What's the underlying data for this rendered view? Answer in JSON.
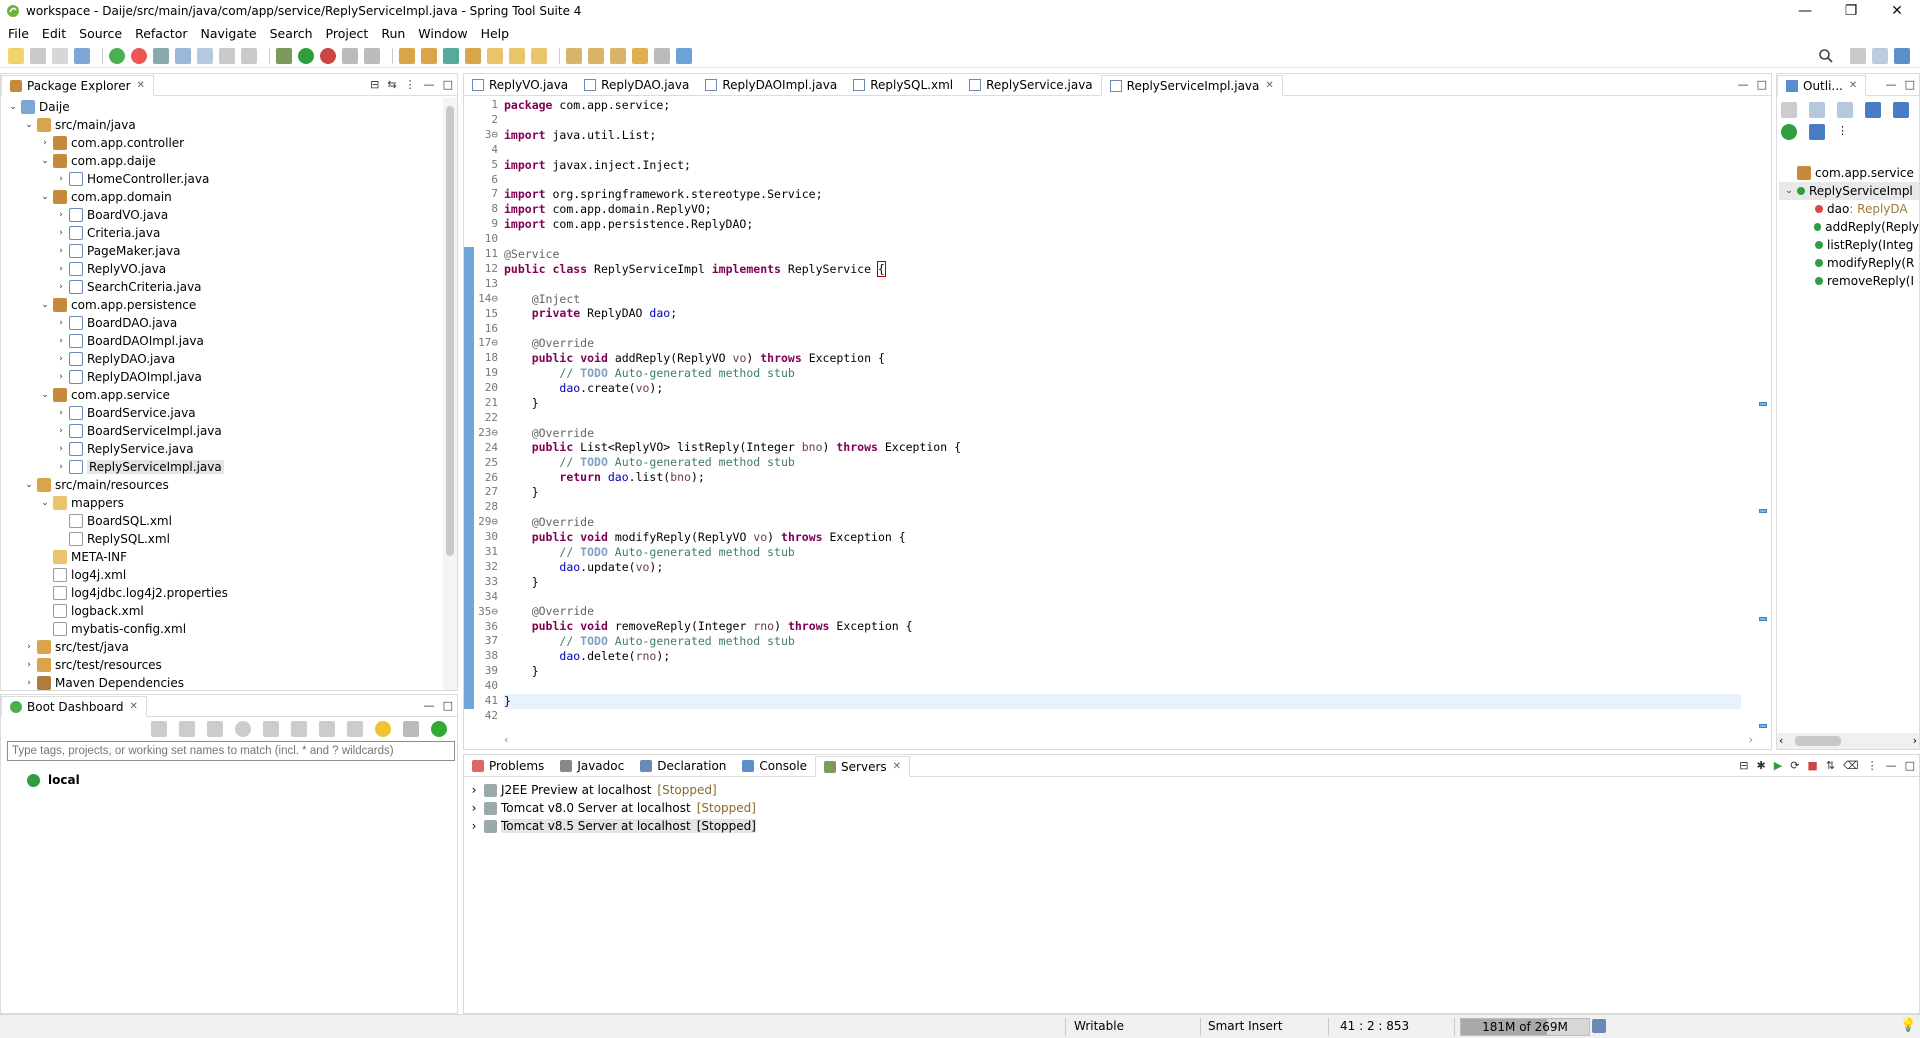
{
  "window": {
    "title": "workspace - Daije/src/main/java/com/app/service/ReplyServiceImpl.java - Spring Tool Suite 4",
    "minimize": "—",
    "restore": "❐",
    "close": "✕"
  },
  "menu": [
    "File",
    "Edit",
    "Source",
    "Refactor",
    "Navigate",
    "Search",
    "Project",
    "Run",
    "Window",
    "Help"
  ],
  "package_explorer": {
    "title": "Package Explorer",
    "tree": [
      {
        "label": "Daije",
        "depth": 0,
        "twisty": "⌄",
        "icon": "proj"
      },
      {
        "label": "src/main/java",
        "depth": 1,
        "twisty": "⌄",
        "icon": "src"
      },
      {
        "label": "com.app.controller",
        "depth": 2,
        "twisty": "›",
        "icon": "pkg"
      },
      {
        "label": "com.app.daije",
        "depth": 2,
        "twisty": "⌄",
        "icon": "pkg"
      },
      {
        "label": "HomeController.java",
        "depth": 3,
        "twisty": "›",
        "icon": "java"
      },
      {
        "label": "com.app.domain",
        "depth": 2,
        "twisty": "⌄",
        "icon": "pkg"
      },
      {
        "label": "BoardVO.java",
        "depth": 3,
        "twisty": "›",
        "icon": "java"
      },
      {
        "label": "Criteria.java",
        "depth": 3,
        "twisty": "›",
        "icon": "java"
      },
      {
        "label": "PageMaker.java",
        "depth": 3,
        "twisty": "›",
        "icon": "java"
      },
      {
        "label": "ReplyVO.java",
        "depth": 3,
        "twisty": "›",
        "icon": "java"
      },
      {
        "label": "SearchCriteria.java",
        "depth": 3,
        "twisty": "›",
        "icon": "java"
      },
      {
        "label": "com.app.persistence",
        "depth": 2,
        "twisty": "⌄",
        "icon": "pkg"
      },
      {
        "label": "BoardDAO.java",
        "depth": 3,
        "twisty": "›",
        "icon": "java"
      },
      {
        "label": "BoardDAOImpl.java",
        "depth": 3,
        "twisty": "›",
        "icon": "java"
      },
      {
        "label": "ReplyDAO.java",
        "depth": 3,
        "twisty": "›",
        "icon": "java"
      },
      {
        "label": "ReplyDAOImpl.java",
        "depth": 3,
        "twisty": "›",
        "icon": "java"
      },
      {
        "label": "com.app.service",
        "depth": 2,
        "twisty": "⌄",
        "icon": "pkg"
      },
      {
        "label": "BoardService.java",
        "depth": 3,
        "twisty": "›",
        "icon": "java"
      },
      {
        "label": "BoardServiceImpl.java",
        "depth": 3,
        "twisty": "›",
        "icon": "java"
      },
      {
        "label": "ReplyService.java",
        "depth": 3,
        "twisty": "›",
        "icon": "java"
      },
      {
        "label": "ReplyServiceImpl.java",
        "depth": 3,
        "twisty": "›",
        "icon": "java",
        "selected": true
      },
      {
        "label": "src/main/resources",
        "depth": 1,
        "twisty": "⌄",
        "icon": "src"
      },
      {
        "label": "mappers",
        "depth": 2,
        "twisty": "⌄",
        "icon": "folder"
      },
      {
        "label": "BoardSQL.xml",
        "depth": 3,
        "twisty": "",
        "icon": "xml"
      },
      {
        "label": "ReplySQL.xml",
        "depth": 3,
        "twisty": "",
        "icon": "xml"
      },
      {
        "label": "META-INF",
        "depth": 2,
        "twisty": "",
        "icon": "folder"
      },
      {
        "label": "log4j.xml",
        "depth": 2,
        "twisty": "",
        "icon": "xml"
      },
      {
        "label": "log4jdbc.log4j2.properties",
        "depth": 2,
        "twisty": "",
        "icon": "xml"
      },
      {
        "label": "logback.xml",
        "depth": 2,
        "twisty": "",
        "icon": "xml"
      },
      {
        "label": "mybatis-config.xml",
        "depth": 2,
        "twisty": "",
        "icon": "xml"
      },
      {
        "label": "src/test/java",
        "depth": 1,
        "twisty": "›",
        "icon": "src"
      },
      {
        "label": "src/test/resources",
        "depth": 1,
        "twisty": "›",
        "icon": "src"
      },
      {
        "label": "Maven Dependencies",
        "depth": 1,
        "twisty": "›",
        "icon": "lib"
      }
    ]
  },
  "boot_dashboard": {
    "title": "Boot Dashboard",
    "filter_placeholder": "Type tags, projects, or working set names to match (incl. * and ? wildcards)",
    "items": [
      "local"
    ]
  },
  "editor": {
    "tabs": [
      "ReplyVO.java",
      "ReplyDAO.java",
      "ReplyDAOImpl.java",
      "ReplySQL.xml",
      "ReplyService.java",
      "ReplyServiceImpl.java"
    ],
    "active_tab": 5,
    "current_line": 41,
    "lines": [
      {
        "n": 1,
        "h": "<span class=\"kw\">package</span> com.app.service;"
      },
      {
        "n": 2,
        "h": ""
      },
      {
        "n": 3,
        "h": "<span class=\"kw\">import</span> java.util.List;",
        "fold": true
      },
      {
        "n": 4,
        "h": ""
      },
      {
        "n": 5,
        "h": "<span class=\"kw\">import</span> javax.inject.Inject;"
      },
      {
        "n": 6,
        "h": ""
      },
      {
        "n": 7,
        "h": "<span class=\"kw\">import</span> org.springframework.stereotype.Service;"
      },
      {
        "n": 8,
        "h": "<span class=\"kw\">import</span> com.app.domain.ReplyVO;"
      },
      {
        "n": 9,
        "h": "<span class=\"kw\">import</span> com.app.persistence.ReplyDAO;"
      },
      {
        "n": 10,
        "h": ""
      },
      {
        "n": 11,
        "h": "<span class=\"ann\">@Service</span>"
      },
      {
        "n": 12,
        "h": "<span class=\"kw\">public</span> <span class=\"kw\">class</span> ReplyServiceImpl <span class=\"kw\">implements</span> ReplyService <span style=\"outline:1px solid #a00;\">{</span>"
      },
      {
        "n": 13,
        "h": ""
      },
      {
        "n": 14,
        "h": "    <span class=\"ann\">@Inject</span>",
        "fold": true
      },
      {
        "n": 15,
        "h": "    <span class=\"kw\">private</span> ReplyDAO <span class=\"fld\">dao</span>;"
      },
      {
        "n": 16,
        "h": ""
      },
      {
        "n": 17,
        "h": "    <span class=\"ann\">@Override</span>",
        "fold": true
      },
      {
        "n": 18,
        "h": "    <span class=\"kw\">public</span> <span class=\"kw\">void</span> addReply(ReplyVO <span class=\"par\">vo</span>) <span class=\"kw\">throws</span> Exception {"
      },
      {
        "n": 19,
        "h": "        <span class=\"cmt\">// <span class=\"todo\">TODO</span> Auto-generated method stub</span>"
      },
      {
        "n": 20,
        "h": "        <span class=\"fld\">dao</span>.create(<span class=\"par\">vo</span>);"
      },
      {
        "n": 21,
        "h": "    }"
      },
      {
        "n": 22,
        "h": ""
      },
      {
        "n": 23,
        "h": "    <span class=\"ann\">@Override</span>",
        "fold": true
      },
      {
        "n": 24,
        "h": "    <span class=\"kw\">public</span> List&lt;ReplyVO&gt; listReply(Integer <span class=\"par\">bno</span>) <span class=\"kw\">throws</span> Exception {"
      },
      {
        "n": 25,
        "h": "        <span class=\"cmt\">// <span class=\"todo\">TODO</span> Auto-generated method stub</span>"
      },
      {
        "n": 26,
        "h": "        <span class=\"kw\">return</span> <span class=\"fld\">dao</span>.list(<span class=\"par\">bno</span>);"
      },
      {
        "n": 27,
        "h": "    }"
      },
      {
        "n": 28,
        "h": ""
      },
      {
        "n": 29,
        "h": "    <span class=\"ann\">@Override</span>",
        "fold": true
      },
      {
        "n": 30,
        "h": "    <span class=\"kw\">public</span> <span class=\"kw\">void</span> modifyReply(ReplyVO <span class=\"par\">vo</span>) <span class=\"kw\">throws</span> Exception {"
      },
      {
        "n": 31,
        "h": "        <span class=\"cmt\">// <span class=\"todo\">TODO</span> Auto-generated method stub</span>"
      },
      {
        "n": 32,
        "h": "        <span class=\"fld\">dao</span>.update(<span class=\"par\">vo</span>);"
      },
      {
        "n": 33,
        "h": "    }"
      },
      {
        "n": 34,
        "h": ""
      },
      {
        "n": 35,
        "h": "    <span class=\"ann\">@Override</span>",
        "fold": true
      },
      {
        "n": 36,
        "h": "    <span class=\"kw\">public</span> <span class=\"kw\">void</span> removeReply(Integer <span class=\"par\">rno</span>) <span class=\"kw\">throws</span> Exception {"
      },
      {
        "n": 37,
        "h": "        <span class=\"cmt\">// <span class=\"todo\">TODO</span> Auto-generated method stub</span>"
      },
      {
        "n": 38,
        "h": "        <span class=\"fld\">dao</span>.delete(<span class=\"par\">rno</span>);"
      },
      {
        "n": 39,
        "h": "    }"
      },
      {
        "n": 40,
        "h": ""
      },
      {
        "n": 41,
        "h": "}"
      },
      {
        "n": 42,
        "h": ""
      }
    ]
  },
  "outline": {
    "title": "Outli...",
    "items": [
      {
        "label": "com.app.service",
        "depth": 0,
        "twisty": "",
        "icon": "pkg"
      },
      {
        "label": "ReplyServiceImpl",
        "depth": 0,
        "twisty": "⌄",
        "icon": "class"
      },
      {
        "label": "dao",
        "suffix": " : ReplyDA",
        "depth": 1,
        "twisty": "",
        "icon": "field"
      },
      {
        "label": "addReply(Reply",
        "depth": 1,
        "twisty": "",
        "icon": "method"
      },
      {
        "label": "listReply(Integ",
        "depth": 1,
        "twisty": "",
        "icon": "method"
      },
      {
        "label": "modifyReply(R",
        "depth": 1,
        "twisty": "",
        "icon": "method"
      },
      {
        "label": "removeReply(I",
        "depth": 1,
        "twisty": "",
        "icon": "method"
      }
    ]
  },
  "bottom_panel": {
    "tabs": [
      "Problems",
      "Javadoc",
      "Declaration",
      "Console",
      "Servers"
    ],
    "active_tab": 4,
    "servers": [
      {
        "name": "J2EE Preview at localhost",
        "state": "[Stopped]"
      },
      {
        "name": "Tomcat v8.0 Server at localhost",
        "state": "[Stopped]"
      },
      {
        "name": "Tomcat v8.5 Server at localhost",
        "state": "[Stopped]",
        "selected": true
      }
    ]
  },
  "statusbar": {
    "writable": "Writable",
    "insert_mode": "Smart Insert",
    "position": "41 : 2 : 853",
    "heap": "181M of 269M",
    "heap_fraction": 0.67
  },
  "colors": {
    "accent": "#3f84c6",
    "keyword": "#7f0055",
    "comment": "#3f7f5f",
    "field": "#0000c0",
    "stopped": "#8b6a2a"
  }
}
